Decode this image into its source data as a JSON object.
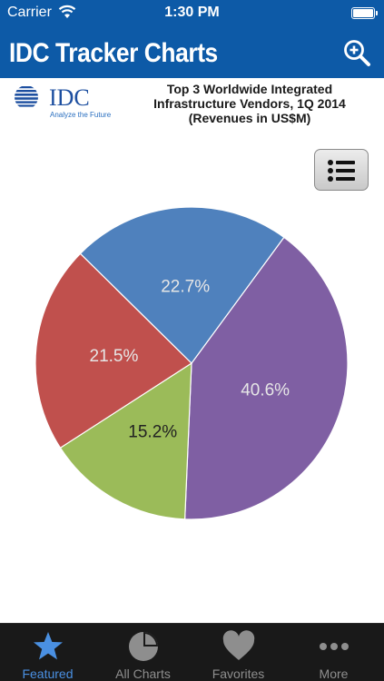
{
  "status_bar": {
    "carrier": "Carrier",
    "time": "1:30 PM",
    "wifi_icon": "wifi-icon",
    "battery_icon": "battery-icon"
  },
  "nav": {
    "title": "IDC Tracker Charts",
    "zoom_icon": "zoom-in-icon"
  },
  "logo": {
    "name": "IDC",
    "tagline": "Analyze the Future"
  },
  "chart_title": {
    "line1": "Top 3 Worldwide Integrated",
    "line2": "Infrastructure Vendors, 1Q 2014",
    "line3": "(Revenues in US$M)"
  },
  "legend_button_icon": "list-icon",
  "chart_data": {
    "type": "pie",
    "title": "Top 3 Worldwide Integrated Infrastructure Vendors, 1Q 2014 (Revenues in US$M)",
    "slices": [
      {
        "label": "40.6%",
        "value": 40.6,
        "color": "#7f5fa3",
        "label_color": "#e6e6e6"
      },
      {
        "label": "15.2%",
        "value": 15.2,
        "color": "#9bbb59",
        "label_color": "#222222"
      },
      {
        "label": "21.5%",
        "value": 21.5,
        "color": "#c0504d",
        "label_color": "#e6e6e6"
      },
      {
        "label": "22.7%",
        "value": 22.7,
        "color": "#4f81bd",
        "label_color": "#e6e6e6"
      }
    ],
    "start_angle_deg": 36.3,
    "direction": "clockwise"
  },
  "tabs": [
    {
      "label": "Featured",
      "icon": "star-icon",
      "active": true
    },
    {
      "label": "All Charts",
      "icon": "pie-chart-icon",
      "active": false
    },
    {
      "label": "Favorites",
      "icon": "heart-icon",
      "active": false
    },
    {
      "label": "More",
      "icon": "more-dots-icon",
      "active": false
    }
  ],
  "colors": {
    "brand_blue": "#0d5aa7",
    "tab_bar_bg": "#191919",
    "tab_active": "#4a90e2",
    "tab_inactive": "#8e8e8e"
  }
}
